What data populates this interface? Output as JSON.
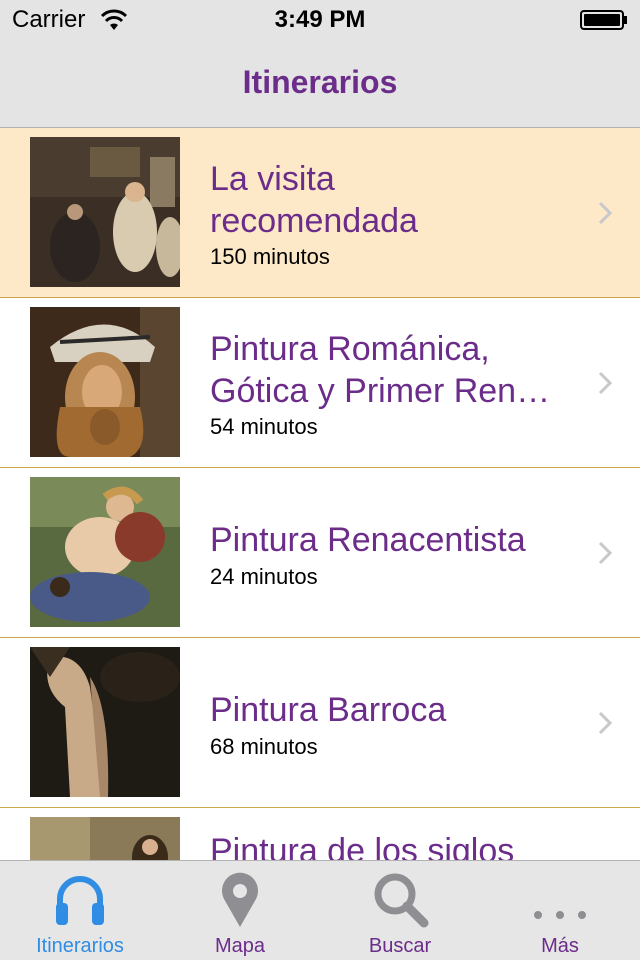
{
  "status_bar": {
    "carrier": "Carrier",
    "time": "3:49 PM"
  },
  "nav": {
    "title": "Itinerarios"
  },
  "colors": {
    "accent": "#6b2c8a",
    "active_tab": "#2f8de4",
    "selected_row": "#fde9c8",
    "separator": "#c8a84a"
  },
  "itineraries": [
    {
      "title_line1": "La visita",
      "title_line2": "recomendada",
      "subtitle": "150 minutos",
      "selected": true
    },
    {
      "title_line1": "Pintura Románica,",
      "title_line2": "Gótica y Primer Ren…",
      "subtitle": "54 minutos",
      "selected": false
    },
    {
      "title_line1": "Pintura Renacentista",
      "subtitle": "24 minutos",
      "selected": false
    },
    {
      "title_line1": "Pintura Barroca",
      "subtitle": "68 minutos",
      "selected": false
    },
    {
      "title_line1": "Pintura de los siglos"
    }
  ],
  "tabs": [
    {
      "label": "Itinerarios",
      "icon": "headphones-icon",
      "active": true
    },
    {
      "label": "Mapa",
      "icon": "map-pin-icon",
      "active": false
    },
    {
      "label": "Buscar",
      "icon": "search-icon",
      "active": false
    },
    {
      "label": "Más",
      "icon": "more-icon",
      "active": false
    }
  ]
}
